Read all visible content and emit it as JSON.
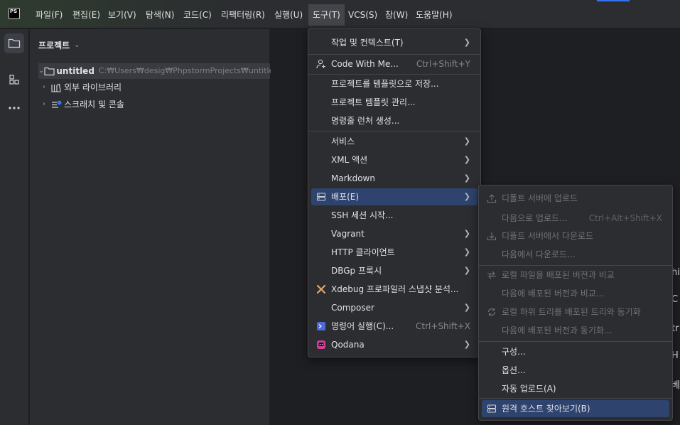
{
  "menubar": {
    "logo": "PS",
    "items": [
      "파일(F)",
      "편집(E)",
      "보기(V)",
      "탐색(N)",
      "코드(C)",
      "리팩터링(R)",
      "실행(U)",
      "도구(T)",
      "VCS(S)",
      "창(W)",
      "도움말(H)"
    ],
    "active_index": 7
  },
  "toolstrip": {
    "icons": [
      "folder-icon",
      "structure-icon",
      "more-icon"
    ]
  },
  "project_panel": {
    "title": "프로젝트",
    "tree": [
      {
        "label": "untitled",
        "path": "C:₩Users₩desig₩PhpstormProjects₩untitled",
        "icon": "folder-icon",
        "expanded": true
      },
      {
        "label": "외부 라이브러리",
        "icon": "library-icon",
        "expanded": false
      },
      {
        "label": "스크래치 및 콘솔",
        "icon": "scratches-icon",
        "expanded": false
      }
    ]
  },
  "editor_edge": [
    "hi",
    "C",
    "tr",
    "H",
    "베"
  ],
  "tools_menu": {
    "items": [
      {
        "label": "작업 및 컨텍스트(T)",
        "submenu": true
      },
      {
        "label": "Code With Me...",
        "shortcut": "Ctrl+Shift+Y",
        "icon": "user-add-icon"
      },
      {
        "label": "프로젝트를 템플릿으로 저장..."
      },
      {
        "label": "프로젝트 템플릿 관리..."
      },
      {
        "label": "명령줄 런처 생성..."
      },
      {
        "label": "서비스",
        "submenu": true
      },
      {
        "label": "XML 액션",
        "submenu": true
      },
      {
        "label": "Markdown",
        "submenu": true
      },
      {
        "label": "배포(E)",
        "submenu": true,
        "icon": "server-icon",
        "highlighted": true
      },
      {
        "label": "SSH 세션 시작..."
      },
      {
        "label": "Vagrant",
        "submenu": true
      },
      {
        "label": "HTTP 클라이언트",
        "submenu": true
      },
      {
        "label": "DBGp 프록시",
        "submenu": true
      },
      {
        "label": "Xdebug 프로파일러 스냅샷 분석...",
        "icon": "xdebug-icon"
      },
      {
        "label": "Composer",
        "submenu": true
      },
      {
        "label": "명령어 실행(C)...",
        "shortcut": "Ctrl+Shift+X",
        "icon": "terminal-icon"
      },
      {
        "label": "Qodana",
        "submenu": true,
        "icon": "qodana-icon"
      }
    ]
  },
  "deploy_menu": {
    "items": [
      {
        "label": "디폴트 서버에 업로드",
        "icon": "upload-icon",
        "disabled": true
      },
      {
        "label": "다음으로 업로드...",
        "shortcut": "Ctrl+Alt+Shift+X",
        "disabled": true
      },
      {
        "label": "디폴트 서버에서 다운로드",
        "icon": "download-icon",
        "disabled": true
      },
      {
        "label": "다음에서 다운로드...",
        "disabled": true
      },
      {
        "label": "로컬 파일을 배포된 버전과 비교",
        "icon": "compare-icon",
        "disabled": true
      },
      {
        "label": "다음에 배포된 버전과 비교...",
        "disabled": true
      },
      {
        "label": "로컬 하위 트리를 배포된 트리와 동기화",
        "icon": "sync-icon",
        "disabled": true
      },
      {
        "label": "다음에 배포된 버전과 동기화...",
        "disabled": true
      },
      {
        "label": "구성..."
      },
      {
        "label": "옵션..."
      },
      {
        "label": "자동 업로드(A)"
      },
      {
        "label": "원격 호스트 찾아보기(B)",
        "icon": "server-icon",
        "highlighted": true
      }
    ]
  },
  "colors": {
    "background": "#1e1f22",
    "panel": "#2b2d30",
    "highlight": "#2e436e",
    "accent": "#3574f0"
  }
}
